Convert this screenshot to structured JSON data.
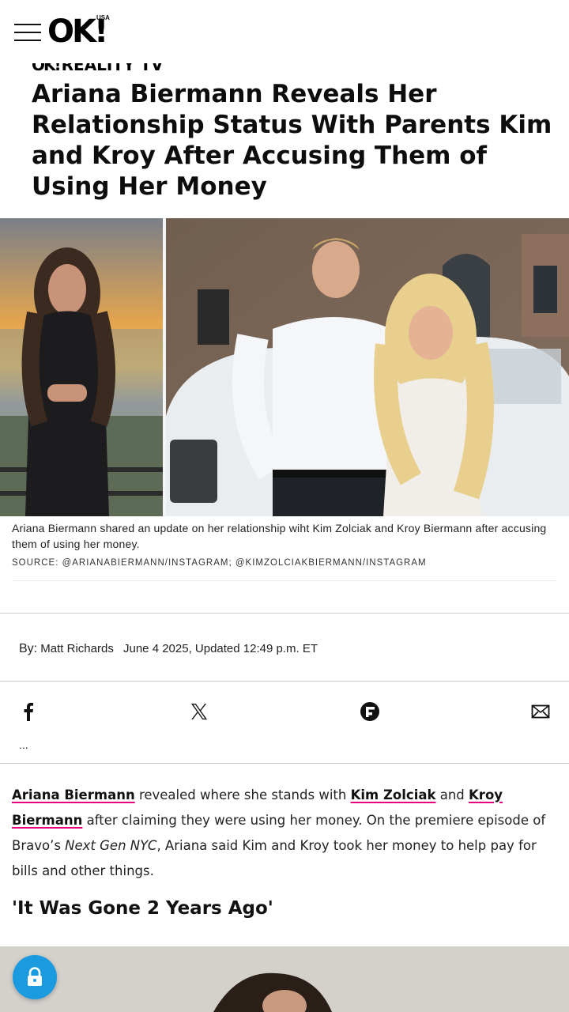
{
  "header": {
    "logo_text": "OK!",
    "logo_edition": "USA"
  },
  "article": {
    "category": "REALITY TV",
    "headline": "Ariana Biermann Reveals Her Relationship Status With Parents Kim and Kroy After Accusing Them of Using Her Money",
    "caption": "Ariana Biermann shared an update on her relationship wiht Kim Zolciak and Kroy Biermann after accusing them of using her money.",
    "source": "SOURCE: @ARIANABIERMANN/INSTAGRAM; @KIMZOLCIAKBIERMANN/INSTAGRAM",
    "byline_prefix": "By:",
    "author": "Matt Richards",
    "date": "June 4 2025, Updated 12:49 p.m. ET",
    "more_label": "...",
    "body": {
      "link1": "Ariana Biermann",
      "text1": " revealed where she stands with ",
      "link2": "Kim Zolciak",
      "text2": " and ",
      "link3": "Kroy Biermann",
      "text3": " after claiming they were using her money. On the premiere episode of Bravo’s ",
      "show_title": "Next Gen NYC",
      "text4": ", Ariana said Kim and Kroy took her money to help pay for bills and other things."
    },
    "subheading": "'It Was Gone 2 Years Ago'"
  },
  "share": {
    "icons": [
      "facebook-icon",
      "x-icon",
      "flipboard-icon",
      "email-icon"
    ]
  },
  "colors": {
    "link_underline": "#e6007e",
    "lock_button": "#1a9be0"
  }
}
